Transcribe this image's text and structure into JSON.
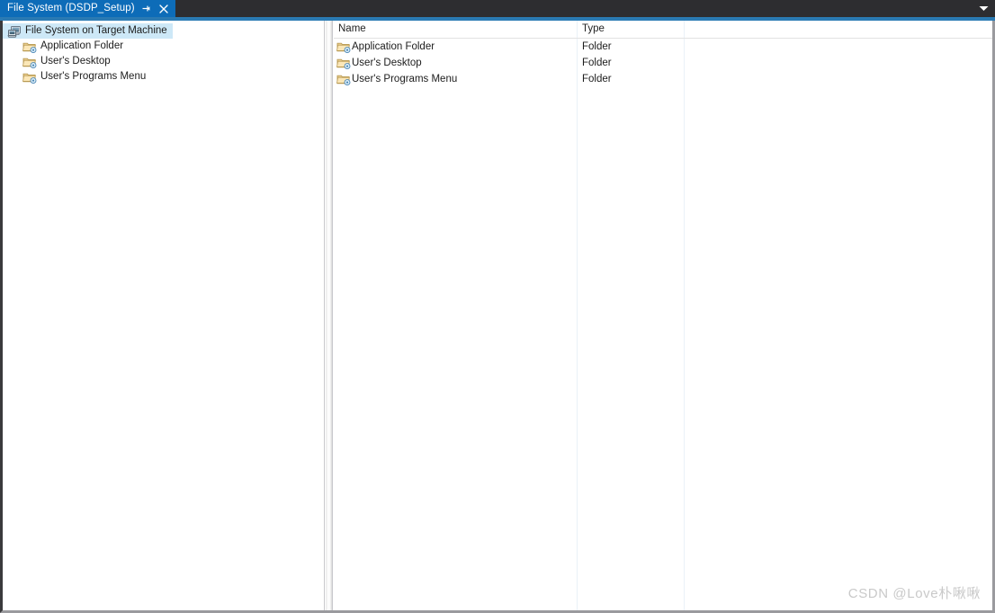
{
  "window": {
    "tab": {
      "label": "File System (DSDP_Setup)",
      "pin_icon": "pin-icon",
      "close_icon": "close-icon",
      "active": true
    },
    "tabbar_overflow_icon": "chevron-down-icon",
    "colors": {
      "titlebar_bg": "#2d2d30",
      "tab_active_bg": "#0d6cb8",
      "tabstrip_underline": "#2a7ab3",
      "selection_bg": "#cde8f7",
      "gridline": "#eaf1f8",
      "text": "#1c1c1c"
    }
  },
  "tree": {
    "root": {
      "label": "File System on Target Machine",
      "icon": "computer-icon",
      "selected": true
    },
    "children": [
      {
        "label": "Application Folder",
        "icon": "folder-special-icon"
      },
      {
        "label": "User's Desktop",
        "icon": "folder-special-icon"
      },
      {
        "label": "User's Programs Menu",
        "icon": "folder-special-icon"
      }
    ]
  },
  "list": {
    "columns": [
      {
        "key": "name",
        "label": "Name"
      },
      {
        "key": "type",
        "label": "Type"
      }
    ],
    "rows": [
      {
        "name": "Application Folder",
        "type": "Folder",
        "icon": "folder-special-icon"
      },
      {
        "name": "User's Desktop",
        "type": "Folder",
        "icon": "folder-special-icon"
      },
      {
        "name": "User's Programs Menu",
        "type": "Folder",
        "icon": "folder-special-icon"
      }
    ]
  },
  "watermark": {
    "text": "CSDN @Love朴啾啾"
  }
}
